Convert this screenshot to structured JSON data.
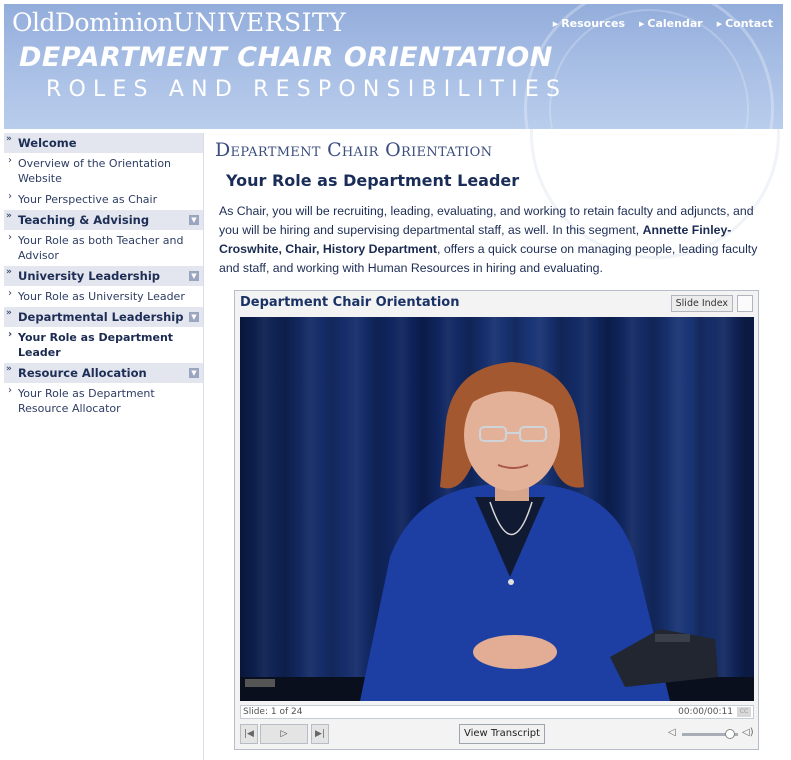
{
  "header": {
    "logo_left": "OldDominion",
    "logo_right": "UNIVERSITY",
    "nav": [
      "Resources",
      "Calendar",
      "Contact"
    ],
    "title": "DEPARTMENT CHAIR ORIENTATION",
    "subtitle": "ROLES AND RESPONSIBILITIES"
  },
  "sidebar": {
    "sections": [
      {
        "label": "Welcome",
        "items": [
          "Overview of the Orientation Website",
          "Your Perspective as Chair"
        ]
      },
      {
        "label": "Teaching & Advising",
        "items": [
          "Your Role as both Teacher and Advisor"
        ]
      },
      {
        "label": "University Leadership",
        "items": [
          "Your Role as University Leader"
        ]
      },
      {
        "label": "Departmental Leadership",
        "items": [
          "Your Role as Department Leader"
        ]
      },
      {
        "label": "Resource Allocation",
        "items": [
          "Your Role as Department Resource Allocator"
        ]
      }
    ]
  },
  "main": {
    "page_heading": "Department Chair Orientation",
    "segment_title": "Your Role as Department Leader",
    "intro_before": "As Chair, you will be recruiting, leading, evaluating, and working to retain faculty and adjuncts, and you will be hiring and supervising departmental staff, as well. In this segment,",
    "intro_name": "Annette Finley-Croswhite, Chair, History Department",
    "intro_after": ", offers a quick course on managing people, leading faculty and staff, and working with Human Resources in hiring and evaluating."
  },
  "player": {
    "title": "Department Chair Orientation",
    "slide_index_label": "Slide Index",
    "slide_status": "Slide: 1 of 24",
    "time": "00:00/00:11",
    "cc_label": "CC",
    "transcript_label": "View Transcript",
    "volume_level": 0.85
  },
  "colors": {
    "header_bg": "#a6bde4",
    "nav_bg": "#e3e6ee",
    "accent": "#1a2d58"
  },
  "icons": [
    "chevron-right-icon",
    "expand-icon",
    "prev-icon",
    "play-icon",
    "next-icon",
    "speaker-icon",
    "speaker-loud-icon"
  ]
}
